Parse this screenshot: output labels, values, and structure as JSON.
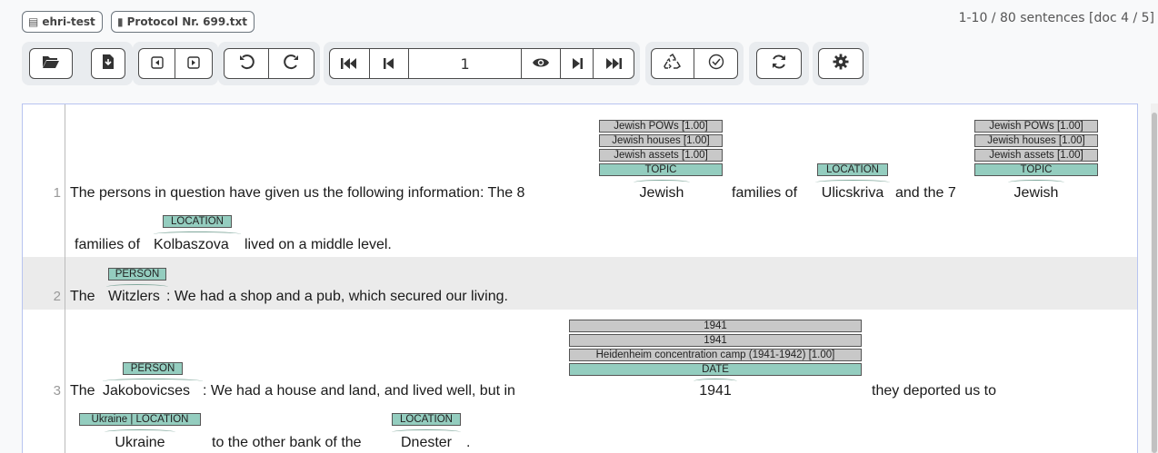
{
  "breadcrumb": {
    "project": "ehri-test",
    "document": "Protocol Nr. 699.txt"
  },
  "counter": "1-10 / 80 sentences [doc 4 / 5]",
  "toolbar": {
    "page_input_value": "1",
    "icons": [
      "folder-open-icon",
      "file-import-icon",
      "prev-doc-icon",
      "next-doc-icon",
      "undo-icon",
      "redo-icon",
      "first-page-icon",
      "prev-page-icon",
      "eye-icon",
      "next-page-icon",
      "last-page-icon",
      "recycle-icon",
      "check-circle-icon",
      "refresh-icon",
      "gear-icon"
    ]
  },
  "sentences": [
    {
      "number": "1",
      "line1": {
        "text_a": "The persons in question have given us the following information: The 8",
        "token_a": "Jewish",
        "text_b": "families of",
        "token_b": "Ulicskriva",
        "text_c": "and the 7",
        "token_c": "Jewish"
      },
      "line2": {
        "text_a": "families of",
        "token_a": "Kolbaszova",
        "text_b": "lived on a middle level."
      },
      "annotations": {
        "jewish1": [
          "Jewish POWs [1.00]",
          "Jewish houses [1.00]",
          "Jewish assets [1.00]",
          "TOPIC"
        ],
        "ulicskriva": "LOCATION",
        "jewish2": [
          "Jewish POWs [1.00]",
          "Jewish houses [1.00]",
          "Jewish assets [1.00]",
          "TOPIC"
        ],
        "kolbaszova": "LOCATION"
      }
    },
    {
      "number": "2",
      "text_a": "The",
      "token_a": "Witzlers",
      "text_b": ": We had a shop and a pub, which secured our living.",
      "annotations": {
        "witzlers": "PERSON"
      }
    },
    {
      "number": "3",
      "line1": {
        "text_a": "The",
        "token_a": "Jakobovicses",
        "text_b": ": We had a house and land, and lived well, but in",
        "token_b": "1941",
        "text_c": "they deported us to"
      },
      "line2": {
        "token_a": "Ukraine",
        "text_a": "to the other bank of the",
        "token_b": "Dnester",
        "text_b": "."
      },
      "annotations": {
        "jakobovicses": "PERSON",
        "year1941": [
          "1941",
          "1941",
          "Heidenheim concentration camp (1941-1942) [1.00]",
          "DATE"
        ],
        "ukraine": "Ukraine | LOCATION",
        "dnester": "LOCATION"
      }
    }
  ]
}
